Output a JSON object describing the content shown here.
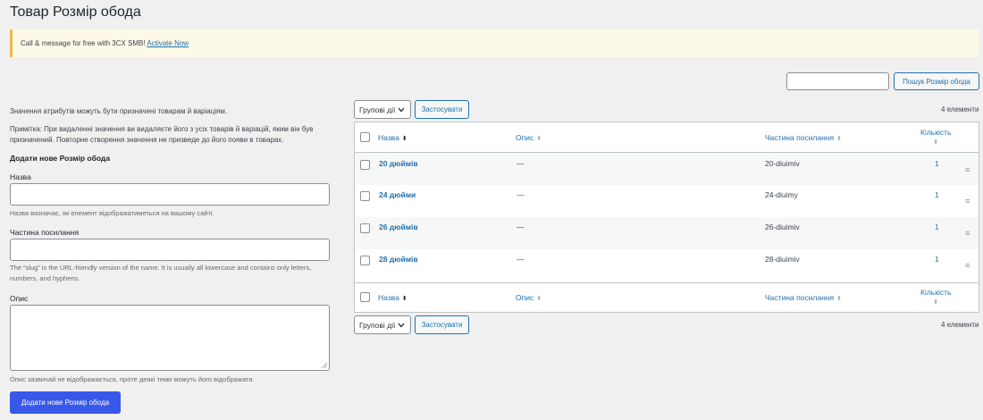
{
  "page": {
    "title": "Товар Розмір обода"
  },
  "notice": {
    "text": "Call & message for free with 3CX SMB!",
    "link": "Activate Now"
  },
  "search": {
    "button": "Пошук Розмір обода",
    "value": ""
  },
  "form": {
    "intro": "Значення атрибутів можуть бути призначені товарам й варіаціям.",
    "note": "Примітка: При видаленні значення ви видаляєте його з усіх товарів й варіацій, яким він був призначений. Повторне створення значення не призведе до його появи в товарах.",
    "heading": "Додати нове Розмір обода",
    "name_label": "Назва",
    "name_desc": "Назва визначає, як елемент відображатиметься на вашому сайті.",
    "slug_label": "Частина посилання",
    "slug_desc": "The “slug” is the URL-friendly version of the name. It is usually all lowercase and contains only letters, numbers, and hyphens.",
    "desc_label": "Опис",
    "desc_desc": "Опис зазвичай не відображається, проте деякі теми можуть його відображати.",
    "submit": "Додати нове Розмір обода"
  },
  "bulk": {
    "select": "Групові дії",
    "apply": "Застосувати",
    "count": "4 елементи"
  },
  "table": {
    "headers": {
      "name": "Назва",
      "desc": "Опис",
      "slug": "Частина посилання",
      "count": "Кількість"
    },
    "rows": [
      {
        "name": "20 дюймів",
        "desc": "—",
        "slug": "20-diuimiv",
        "count": "1"
      },
      {
        "name": "24 дюйми",
        "desc": "—",
        "slug": "24-diuimy",
        "count": "1"
      },
      {
        "name": "26 дюймів",
        "desc": "—",
        "slug": "26-diuimiv",
        "count": "1"
      },
      {
        "name": "28 дюймів",
        "desc": "—",
        "slug": "28-diuimiv",
        "count": "1"
      }
    ]
  },
  "icons": {
    "sort": "sort-arrows-icon",
    "drag": "drag-handle-icon",
    "chevron": "chevron-down-icon"
  }
}
